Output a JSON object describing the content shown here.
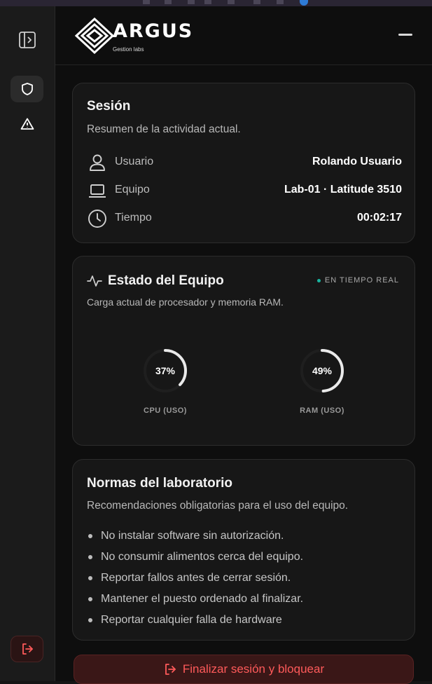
{
  "brand": {
    "name": "ARGUS",
    "subtitle": "Gestion labs"
  },
  "sidebar": {
    "items": [
      {
        "icon": "panel-toggle-icon"
      },
      {
        "icon": "shield-icon",
        "active": true
      },
      {
        "icon": "warning-icon"
      }
    ],
    "logout_icon": "logout-icon"
  },
  "session": {
    "title": "Sesión",
    "subtitle": "Resumen de la actividad actual.",
    "rows": [
      {
        "icon": "user-icon",
        "label": "Usuario",
        "value": "Rolando Usuario"
      },
      {
        "icon": "laptop-icon",
        "label": "Equipo",
        "value": "Lab-01 · Latitude 3510"
      },
      {
        "icon": "clock-icon",
        "label": "Tiempo",
        "value": "00:02:17"
      }
    ]
  },
  "status": {
    "title": "Estado del Equipo",
    "live_label": "EN TIEMPO REAL",
    "subtitle": "Carga actual de procesador y memoria RAM.",
    "gauges": [
      {
        "label": "CPU (USO)",
        "value": 37,
        "display": "37%"
      },
      {
        "label": "RAM (USO)",
        "value": 49,
        "display": "49%"
      }
    ]
  },
  "rules": {
    "title": "Normas del laboratorio",
    "subtitle": "Recomendaciones obligatorias para el uso del equipo.",
    "items": [
      "No instalar software sin autorización.",
      "No consumir alimentos cerca del equipo.",
      "Reportar fallos antes de cerrar sesión.",
      "Mantener el puesto ordenado al finalizar.",
      "Reportar cualquier falla de hardware"
    ]
  },
  "finish_button": {
    "label": "Finalizar sesión y bloquear",
    "icon": "logout-icon"
  },
  "colors": {
    "background": "#0e0e0e",
    "card": "#171717",
    "accent_danger": "#ff5a5a",
    "live_dot": "#19b5a0"
  }
}
